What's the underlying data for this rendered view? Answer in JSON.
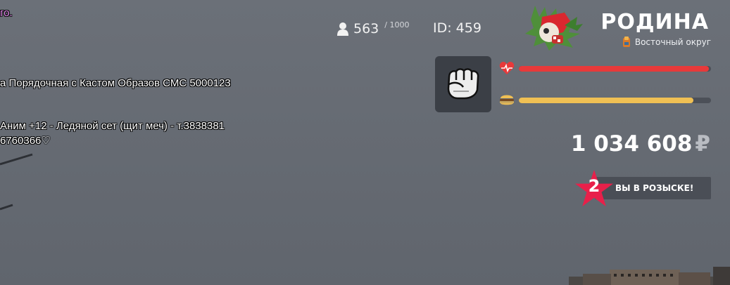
{
  "chat": {
    "lines": [
      {
        "text": "го.",
        "color": "#e68cf0"
      },
      {
        "text": "а Порядочная с Кастом Образов СМС 5000123",
        "color": "#ffffff"
      },
      {
        "text": "Аним +12 - Ледяной сет (щит меч) - т.3838381",
        "color": "#ffffff"
      },
      {
        "text": "6760366♡",
        "color": "#ffffff"
      }
    ]
  },
  "hud": {
    "online": {
      "current": "563",
      "max": "/ 1000",
      "icon": "person-icon"
    },
    "player_id": "ID: 459",
    "server": {
      "name": "РОДИНА",
      "district": "Восточный округ",
      "logo": "server-logo"
    },
    "weapon": {
      "icon": "fist-icon"
    },
    "health": {
      "icon": "heart-icon",
      "level": 0.99,
      "color": "#e8393a"
    },
    "hunger": {
      "icon": "burger-icon",
      "level": 0.91,
      "color": "#f0c054"
    },
    "money": {
      "amount": "1 034 608",
      "currency": "₽"
    },
    "wanted": {
      "level": "2",
      "label": "ВЫ В РОЗЫСКЕ!",
      "star_color": "#e8204a"
    }
  }
}
